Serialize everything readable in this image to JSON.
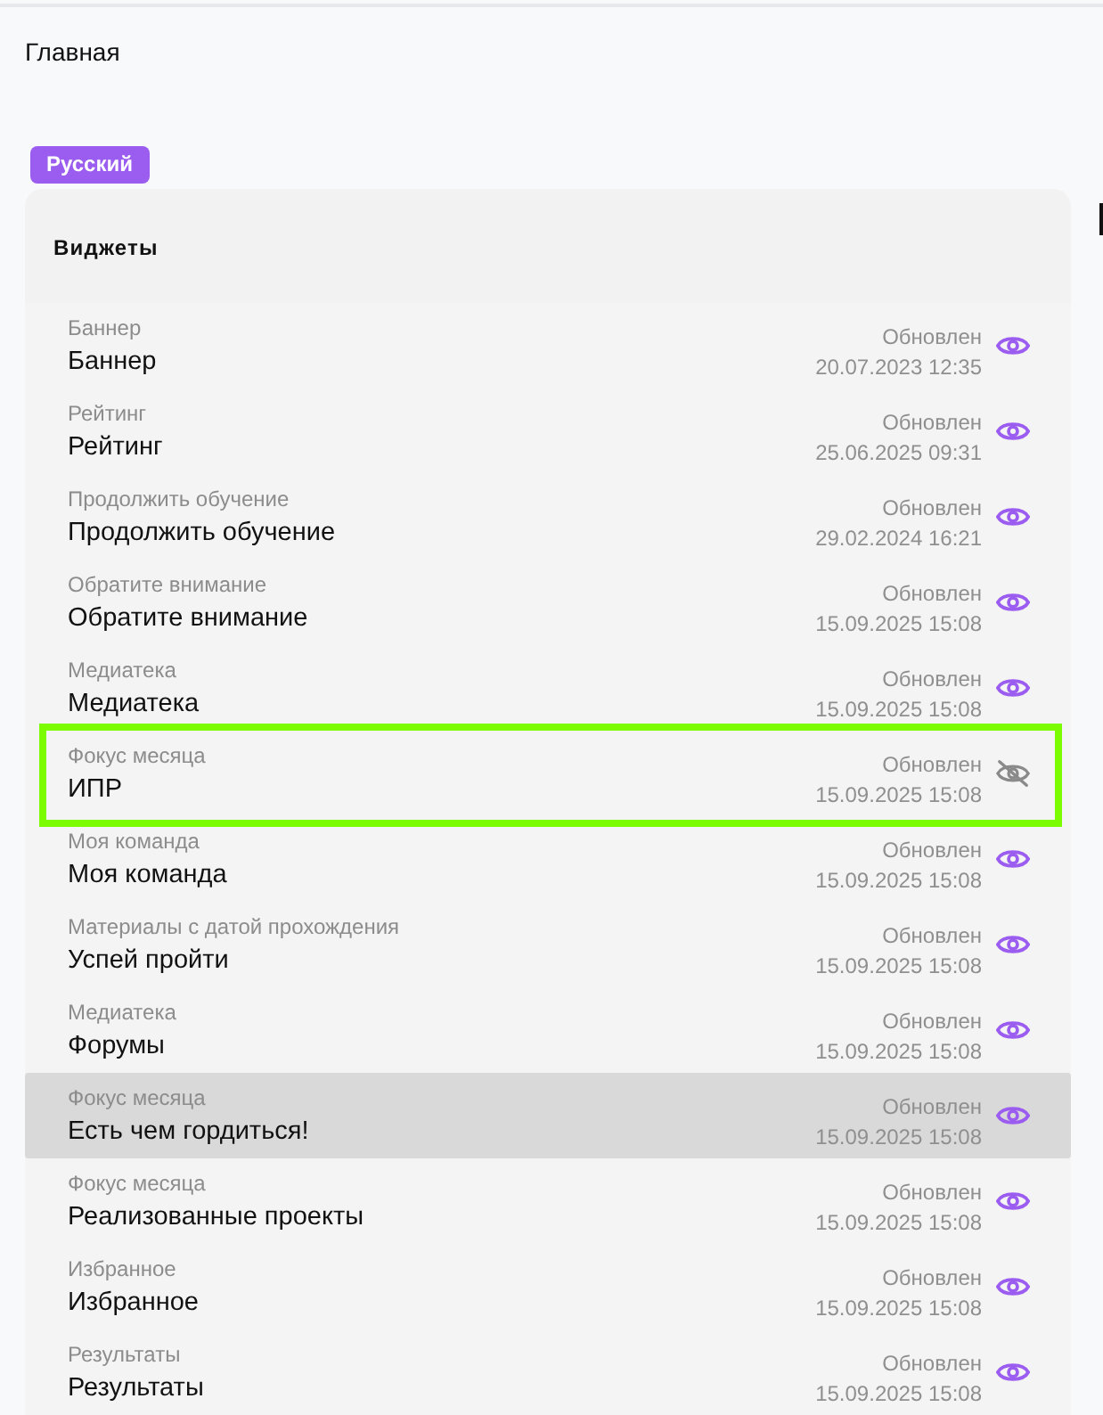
{
  "breadcrumb": "Главная",
  "language_badge": "Русский",
  "widgets": {
    "title": "Виджеты",
    "rows": [
      {
        "type": "Баннер",
        "name": "Баннер",
        "updated_label": "Обновлен",
        "updated_at": "20.07.2023 12:35",
        "visible": true,
        "hovered": false,
        "outlined": false
      },
      {
        "type": "Рейтинг",
        "name": "Рейтинг",
        "updated_label": "Обновлен",
        "updated_at": "25.06.2025 09:31",
        "visible": true,
        "hovered": false,
        "outlined": false
      },
      {
        "type": "Продолжить обучение",
        "name": "Продолжить обучение",
        "updated_label": "Обновлен",
        "updated_at": "29.02.2024 16:21",
        "visible": true,
        "hovered": false,
        "outlined": false
      },
      {
        "type": "Обратите внимание",
        "name": "Обратите внимание",
        "updated_label": "Обновлен",
        "updated_at": "15.09.2025 15:08",
        "visible": true,
        "hovered": false,
        "outlined": false
      },
      {
        "type": "Медиатека",
        "name": "Медиатека",
        "updated_label": "Обновлен",
        "updated_at": "15.09.2025 15:08",
        "visible": true,
        "hovered": false,
        "outlined": false
      },
      {
        "type": "Фокус месяца",
        "name": "ИПР",
        "updated_label": "Обновлен",
        "updated_at": "15.09.2025 15:08",
        "visible": false,
        "hovered": false,
        "outlined": true
      },
      {
        "type": "Моя команда",
        "name": "Моя команда",
        "updated_label": "Обновлен",
        "updated_at": "15.09.2025 15:08",
        "visible": true,
        "hovered": false,
        "outlined": false
      },
      {
        "type": "Материалы с датой прохождения",
        "name": "Успей пройти",
        "updated_label": "Обновлен",
        "updated_at": "15.09.2025 15:08",
        "visible": true,
        "hovered": false,
        "outlined": false
      },
      {
        "type": "Медиатека",
        "name": "Форумы",
        "updated_label": "Обновлен",
        "updated_at": "15.09.2025 15:08",
        "visible": true,
        "hovered": false,
        "outlined": false
      },
      {
        "type": "Фокус месяца",
        "name": "Есть чем гордиться!",
        "updated_label": "Обновлен",
        "updated_at": "15.09.2025 15:08",
        "visible": true,
        "hovered": true,
        "outlined": false
      },
      {
        "type": "Фокус месяца",
        "name": "Реализованные проекты",
        "updated_label": "Обновлен",
        "updated_at": "15.09.2025 15:08",
        "visible": true,
        "hovered": false,
        "outlined": false
      },
      {
        "type": "Избранное",
        "name": "Избранное",
        "updated_label": "Обновлен",
        "updated_at": "15.09.2025 15:08",
        "visible": true,
        "hovered": false,
        "outlined": false
      },
      {
        "type": "Результаты",
        "name": "Результаты",
        "updated_label": "Обновлен",
        "updated_at": "15.09.2025 15:08",
        "visible": true,
        "hovered": false,
        "outlined": false
      }
    ]
  }
}
